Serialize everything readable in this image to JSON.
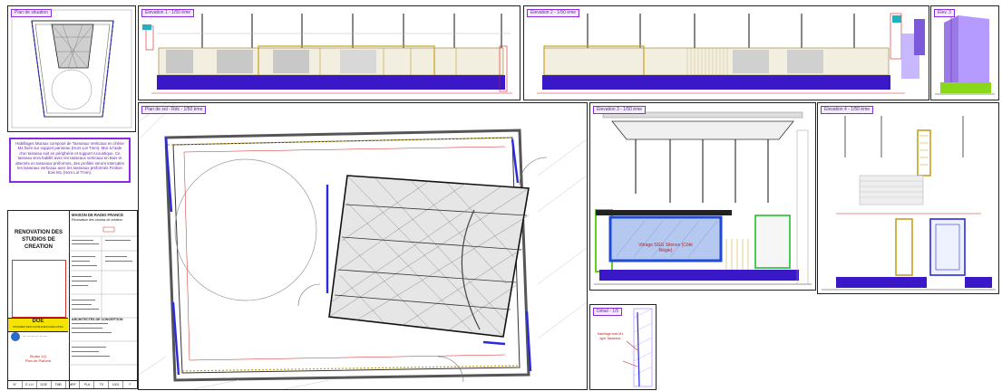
{
  "panels": {
    "plan_thumb": {
      "tag": "Plan de situation"
    },
    "elev1": {
      "tag": "Elevation 1 - 1/50 ème"
    },
    "elev2": {
      "tag": "Elevation 2 - 1/50 ème"
    },
    "elev_small": {
      "tag": "Elev. 3"
    },
    "main_plan": {
      "tag": "Plan de sol - Rdc - 1/50 ème"
    },
    "elev3": {
      "tag": "Elevation 3 - 1/50 ème"
    },
    "elev4": {
      "tag": "Elevation 4 - 1/50 ème"
    },
    "detail": {
      "tag": "Détail - 1/5"
    }
  },
  "note": "Habillages Muraux composé de Tasseaux Verticaux en chêne M1 fixés sur support panneau (Hors Lot Tmm). Mur à l'aide d'un tasseau soit en périphérie et support Acoustique. Ce tasseau sera habillé avec les tasseaux verticaux en Bois et alternés en tasseaux préformés, des profilés seront intercalés les tasseaux verticaux avec les tasseaux préformés Finition bois M1 (Hors Lot Tmm).",
  "title_block": {
    "project": "RENOVATION DES STUDIOS DE CREATION",
    "client_title": "MAISON DE RADIO FRANCE",
    "client_sub": "Rénovation des studios de création",
    "doe": "DOE",
    "doe_sub": "DOSSIER DES OUVRAGES EXECUTES",
    "architect": "ARCHITECTES DE CONCEPTION",
    "drawing_name": "Studio 111",
    "drawing_sub": "Plan de Plafond",
    "bottom_row": [
      "N°",
      "E.1.H",
      "DOE",
      "TMB",
      "MRF",
      "PLA",
      "TS",
      "1001",
      "F"
    ]
  },
  "labels": {
    "glass": "Vitrage SGG Silence (Côté Régie)",
    "detail_note": "Habillage bois M1 type Tasseaux"
  }
}
